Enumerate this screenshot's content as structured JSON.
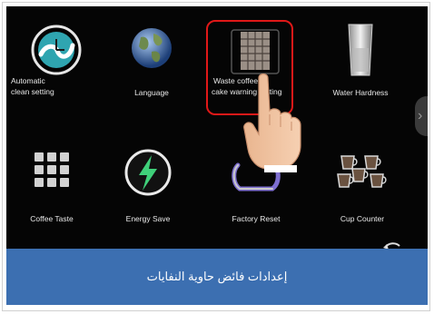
{
  "screen": {
    "tiles": [
      {
        "name": "automatic-clean-setting",
        "icon": "clean-cycle-icon",
        "label_line1": "Automatic",
        "label_line2": "clean setting"
      },
      {
        "name": "language",
        "icon": "globe-icon",
        "label": "Language"
      },
      {
        "name": "waste-coffee-cake",
        "icon": "waste-container-icon",
        "label_line1": "Waste coffee",
        "label_line2": "cake warning setting"
      },
      {
        "name": "water-hardness",
        "icon": "water-glass-icon",
        "label": "Water Hardness"
      },
      {
        "name": "coffee-taste",
        "icon": "grid-icon",
        "label": "Coffee Taste"
      },
      {
        "name": "energy-save",
        "icon": "lightning-icon",
        "label": "Energy Save"
      },
      {
        "name": "factory-reset",
        "icon": "reset-icon",
        "label": "Factory Reset"
      },
      {
        "name": "cup-counter",
        "icon": "cups-icon",
        "label": "Cup Counter"
      }
    ],
    "side_arrow": "›"
  },
  "caption": "إعدادات فائض حاوية النفايات",
  "colors": {
    "caption_bg": "#3c6fb1",
    "highlight": "#e01818",
    "screen_bg": "#050505",
    "accent_green": "#3fd07a"
  }
}
